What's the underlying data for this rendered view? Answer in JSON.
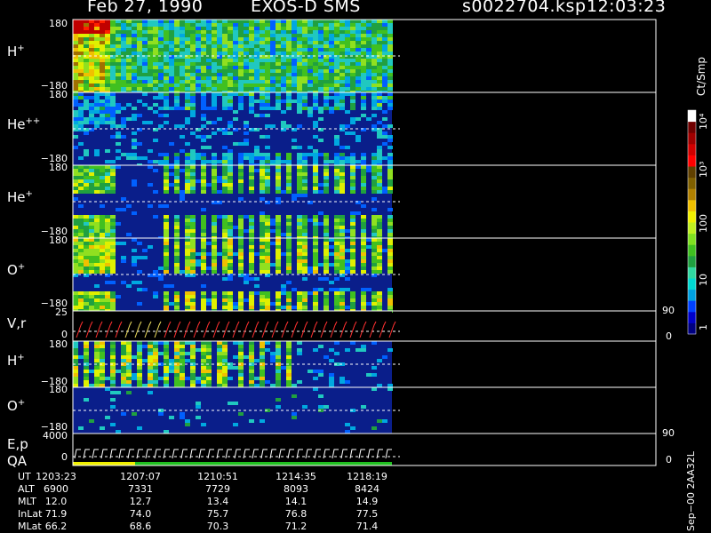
{
  "header": {
    "date": "Feb 27, 1990",
    "instrument": "EXOS-D SMS",
    "file": "s0022704.ksp",
    "time": "12:03:23"
  },
  "panels": [
    {
      "id": "h1",
      "label": "H",
      "sup": "+",
      "ytop": "180",
      "ybot": "−180"
    },
    {
      "id": "he2",
      "label": "He",
      "sup": "++",
      "ytop": "180",
      "ybot": "−180"
    },
    {
      "id": "he1",
      "label": "He",
      "sup": "+",
      "ytop": "180",
      "ybot": "−180"
    },
    {
      "id": "o1",
      "label": "O",
      "sup": "+",
      "ytop": "180",
      "ybot": "−180"
    },
    {
      "id": "vr",
      "label": "V,r",
      "sup": "",
      "ytop": "25",
      "ybot": "0",
      "rtop": "90",
      "rbot": "0"
    },
    {
      "id": "h2",
      "label": "H",
      "sup": "+",
      "ytop": "180",
      "ybot": "−180"
    },
    {
      "id": "o2",
      "label": "O",
      "sup": "+",
      "ytop": "180",
      "ybot": "−180"
    },
    {
      "id": "ep",
      "label": "E,p",
      "label2": "QA",
      "sup": "",
      "ytop": "4000",
      "ybot": "0",
      "rtop": "90",
      "rbot": "0"
    }
  ],
  "colorbar": {
    "unit": "Ct/Smp",
    "labels": [
      "1",
      "10",
      "100",
      "10³",
      "10⁴"
    ],
    "colors": [
      "#000080",
      "#0000c8",
      "#0040ff",
      "#00a0e0",
      "#00d8d0",
      "#30d8a0",
      "#20a040",
      "#40c020",
      "#80e020",
      "#c0f020",
      "#f0f000",
      "#f0c000",
      "#b08000",
      "#806000",
      "#604000",
      "#ff0000",
      "#d00000",
      "#a00000",
      "#700000",
      "#ffffff"
    ]
  },
  "footer": {
    "code": "Sep−00  2AA32L",
    "rows": [
      {
        "name": "UT",
        "values": [
          "1203:23",
          "1207:07",
          "1210:51",
          "1214:35",
          "1218:19"
        ]
      },
      {
        "name": "ALT",
        "values": [
          "6900",
          "7331",
          "7729",
          "8093",
          "8424"
        ]
      },
      {
        "name": "MLT",
        "values": [
          "12.0",
          "12.7",
          "13.4",
          "14.1",
          "14.9"
        ]
      },
      {
        "name": "InLat",
        "values": [
          "71.9",
          "74.0",
          "75.7",
          "76.8",
          "77.5"
        ]
      },
      {
        "name": "MLat",
        "values": [
          "66.2",
          "68.6",
          "70.3",
          "71.2",
          "71.4"
        ]
      }
    ]
  },
  "chart_data": {
    "type": "heatmap",
    "title": "Feb 27, 1990   EXOS-D SMS",
    "x_ticks_ut": [
      "1203:23",
      "1207:07",
      "1210:51",
      "1214:35",
      "1218:19"
    ],
    "ylim": [
      -180,
      180
    ],
    "colorscale_unit": "Ct/Smp",
    "colorscale_range": [
      "1",
      "10⁴"
    ],
    "series": [
      {
        "name": "H+"
      },
      {
        "name": "He++"
      },
      {
        "name": "He+"
      },
      {
        "name": "O+"
      },
      {
        "name": "V,r"
      },
      {
        "name": "H+"
      },
      {
        "name": "O+"
      },
      {
        "name": "E,p QA"
      }
    ]
  }
}
